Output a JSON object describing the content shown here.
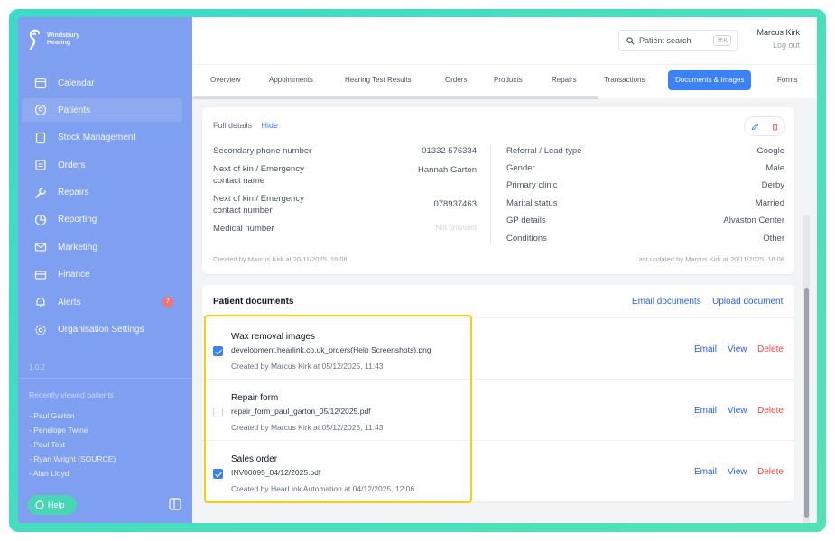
{
  "sidebar": {
    "logo_line1": "Windsbury",
    "logo_line2": "Hearing",
    "items": [
      {
        "label": "Calendar",
        "icon": "calendar-icon"
      },
      {
        "label": "Patients",
        "icon": "patients-icon"
      },
      {
        "label": "Stock Management",
        "icon": "stock-icon"
      },
      {
        "label": "Orders",
        "icon": "orders-icon"
      },
      {
        "label": "Repairs",
        "icon": "wrench-icon"
      },
      {
        "label": "Reporting",
        "icon": "chart-icon"
      },
      {
        "label": "Marketing",
        "icon": "mail-icon"
      },
      {
        "label": "Finance",
        "icon": "card-icon"
      },
      {
        "label": "Alerts",
        "icon": "bell-icon",
        "badge": "7"
      },
      {
        "label": "Organisation Settings",
        "icon": "gear-icon"
      }
    ],
    "version": "1.0.2",
    "recent_title": "Recently viewed patients",
    "recent": [
      "- Paul Garton",
      "- Penelope Twine",
      "- Paul Test",
      "- Ryan Wright (SOURCE)",
      "- Alan Lloyd"
    ],
    "help_label": "Help"
  },
  "topbar": {
    "search_placeholder": "Patient search",
    "search_shortcut": "⌘K",
    "user_name": "Marcus Kirk",
    "logout": "Log out"
  },
  "tabs": [
    "Overview",
    "Appointments",
    "Hearing Test Results",
    "Orders",
    "Products",
    "Repairs",
    "Transactions",
    "Documents & Images",
    "Forms"
  ],
  "active_tab": "Documents & Images",
  "details": {
    "header": "Full details",
    "hide": "Hide",
    "left": [
      {
        "label": "Secondary phone number",
        "value": "01332 576334"
      },
      {
        "label": "Next of kin / Emergency contact name",
        "value": "Hannah Garton"
      },
      {
        "label": "Next of kin / Emergency contact number",
        "value": "078937463"
      },
      {
        "label": "Medical number",
        "value": "Not provided"
      }
    ],
    "right": [
      {
        "label": "Referral / Lead type",
        "value": "Google"
      },
      {
        "label": "Gender",
        "value": "Male"
      },
      {
        "label": "Primary clinic",
        "value": "Derby"
      },
      {
        "label": "Marital status",
        "value": "Married"
      },
      {
        "label": "GP details",
        "value": "Alvaston Center"
      },
      {
        "label": "Conditions",
        "value": "Other"
      }
    ],
    "created": "Created by Marcus Kirk at 20/11/2025, 16:08",
    "updated": "Last updated by Marcus Kirk at 20/11/2025, 16:08"
  },
  "documents": {
    "title": "Patient documents",
    "email_all": "Email documents",
    "upload": "Upload document",
    "rows": [
      {
        "name": "Wax removal images",
        "file": "development.hearlink.co.uk_orders(Help Screenshots).png",
        "meta": "Created by Marcus Kirk at 05/12/2025, 11:43",
        "checked": true
      },
      {
        "name": "Repair form",
        "file": "repair_form_paul_garton_05/12/2025.pdf",
        "meta": "Created by Marcus Kirk at 05/12/2025, 11:43",
        "checked": false
      },
      {
        "name": "Sales order",
        "file": "INV00095_04/12/2025.pdf",
        "meta": "Created by HearLink Automation at 04/12/2025, 12:06",
        "checked": true
      }
    ],
    "actions": {
      "email": "Email",
      "view": "View",
      "delete": "Delete"
    }
  },
  "colors": {
    "sidebar": "#7f9ff0",
    "accent": "#3b82f6",
    "highlight": "#facc15",
    "frame": "#3dd8c8",
    "danger": "#ef4444"
  }
}
